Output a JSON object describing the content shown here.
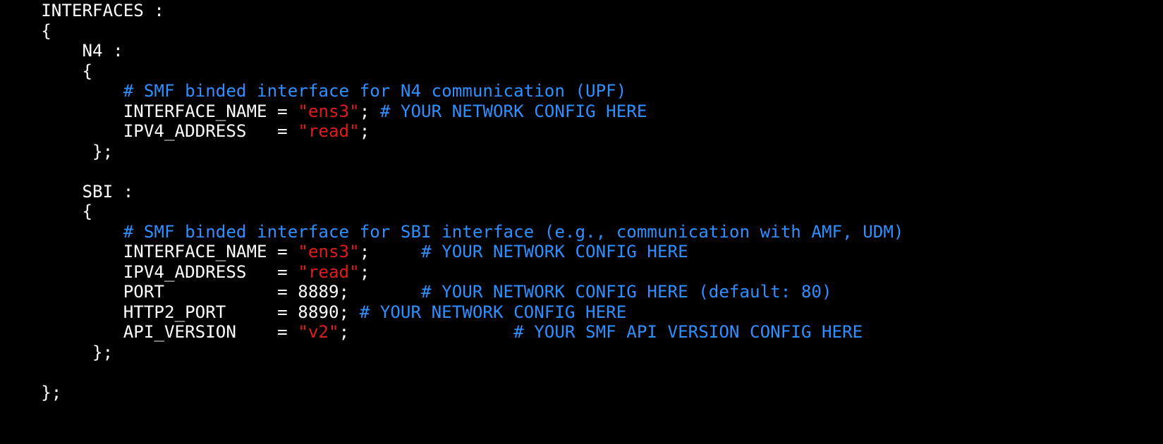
{
  "colors": {
    "background": "#000000",
    "text": "#ffffff",
    "string": "#e01b1b",
    "comment": "#2f8fff"
  },
  "lines": [
    {
      "segments": [
        {
          "t": "    INTERFACES :",
          "c": "plain"
        }
      ]
    },
    {
      "segments": [
        {
          "t": "    {",
          "c": "plain"
        }
      ]
    },
    {
      "segments": [
        {
          "t": "        N4 :",
          "c": "plain"
        }
      ]
    },
    {
      "segments": [
        {
          "t": "        {",
          "c": "plain"
        }
      ]
    },
    {
      "segments": [
        {
          "t": "            ",
          "c": "plain"
        },
        {
          "t": "# SMF binded interface for N4 communication (UPF)",
          "c": "cmt"
        }
      ]
    },
    {
      "segments": [
        {
          "t": "            INTERFACE_NAME = ",
          "c": "plain"
        },
        {
          "t": "\"ens3\"",
          "c": "str"
        },
        {
          "t": "; ",
          "c": "plain"
        },
        {
          "t": "# YOUR NETWORK CONFIG HERE",
          "c": "cmt"
        }
      ]
    },
    {
      "segments": [
        {
          "t": "            IPV4_ADDRESS   = ",
          "c": "plain"
        },
        {
          "t": "\"read\"",
          "c": "str"
        },
        {
          "t": ";",
          "c": "plain"
        }
      ]
    },
    {
      "segments": [
        {
          "t": "         };",
          "c": "plain"
        }
      ]
    },
    {
      "segments": [
        {
          "t": "",
          "c": "plain"
        }
      ]
    },
    {
      "segments": [
        {
          "t": "        SBI :",
          "c": "plain"
        }
      ]
    },
    {
      "segments": [
        {
          "t": "        {",
          "c": "plain"
        }
      ]
    },
    {
      "segments": [
        {
          "t": "            ",
          "c": "plain"
        },
        {
          "t": "# SMF binded interface for SBI interface (e.g., communication with AMF, UDM)",
          "c": "cmt"
        }
      ]
    },
    {
      "segments": [
        {
          "t": "            INTERFACE_NAME = ",
          "c": "plain"
        },
        {
          "t": "\"ens3\"",
          "c": "str"
        },
        {
          "t": ";     ",
          "c": "plain"
        },
        {
          "t": "# YOUR NETWORK CONFIG HERE",
          "c": "cmt"
        }
      ]
    },
    {
      "segments": [
        {
          "t": "            IPV4_ADDRESS   = ",
          "c": "plain"
        },
        {
          "t": "\"read\"",
          "c": "str"
        },
        {
          "t": ";",
          "c": "plain"
        }
      ]
    },
    {
      "segments": [
        {
          "t": "            PORT           = 8889;       ",
          "c": "plain"
        },
        {
          "t": "# YOUR NETWORK CONFIG HERE (default: 80)",
          "c": "cmt"
        }
      ]
    },
    {
      "segments": [
        {
          "t": "            HTTP2_PORT     = 8890; ",
          "c": "plain"
        },
        {
          "t": "# YOUR NETWORK CONFIG HERE",
          "c": "cmt"
        }
      ]
    },
    {
      "segments": [
        {
          "t": "            API_VERSION    = ",
          "c": "plain"
        },
        {
          "t": "\"v2\"",
          "c": "str"
        },
        {
          "t": ";                ",
          "c": "plain"
        },
        {
          "t": "# YOUR SMF API VERSION CONFIG HERE",
          "c": "cmt"
        }
      ]
    },
    {
      "segments": [
        {
          "t": "         };",
          "c": "plain"
        }
      ]
    },
    {
      "segments": [
        {
          "t": "",
          "c": "plain"
        }
      ]
    },
    {
      "segments": [
        {
          "t": "    };",
          "c": "plain"
        }
      ]
    }
  ]
}
